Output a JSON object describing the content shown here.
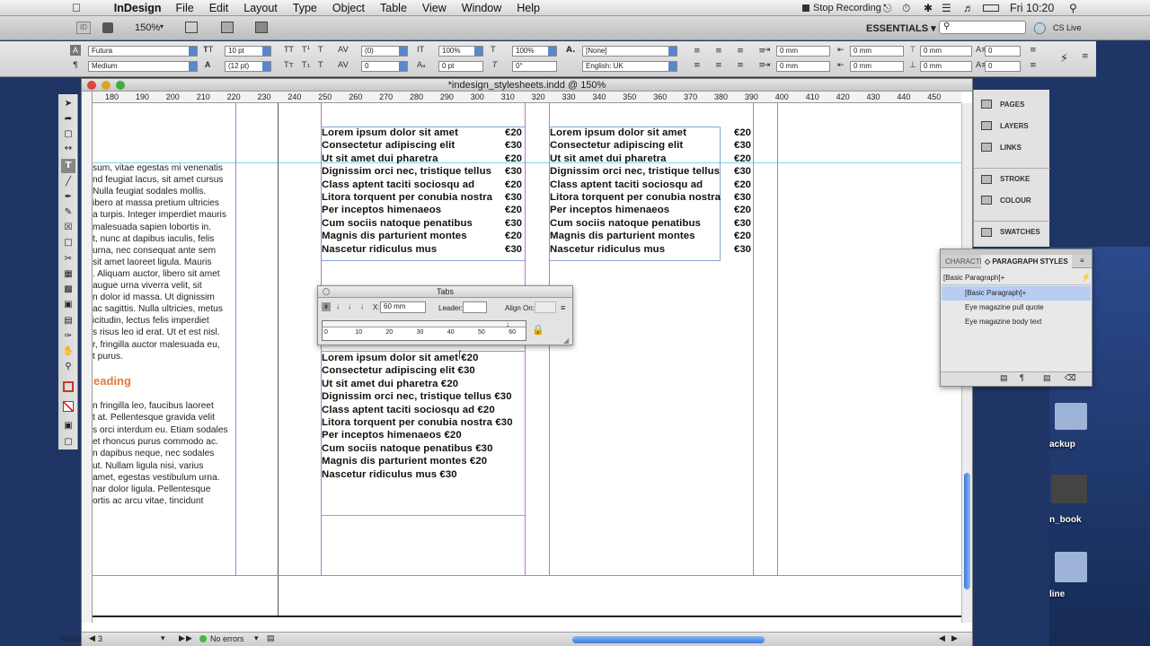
{
  "menubar": {
    "app": "InDesign",
    "items": [
      "File",
      "Edit",
      "Layout",
      "Type",
      "Object",
      "Table",
      "View",
      "Window",
      "Help"
    ],
    "recording": "Stop Recording",
    "clock": "Fri 10:20"
  },
  "appbar": {
    "zoom": "150%",
    "workspace": "ESSENTIALS ▾",
    "cs_live": "CS Live"
  },
  "control": {
    "font": "Futura",
    "style": "Medium",
    "size": "10 pt",
    "leading": "(12 pt)",
    "kerning": "(0)",
    "tracking": "0",
    "vscale": "100%",
    "hscale": "100%",
    "baseline": "0 pt",
    "skew": "0°",
    "char_style": "[None]",
    "language": "English: UK",
    "indent_left": "0 mm",
    "indent_right": "0 mm",
    "first_line": "0 mm",
    "last_line": "0 mm",
    "space_before": "0 mm",
    "space_after": "0 mm",
    "drop_cap_lines": "0",
    "drop_cap_chars": "0"
  },
  "document": {
    "title": "*indesign_stylesheets.indd @ 150%",
    "ruler_ticks": [
      "180",
      "190",
      "200",
      "210",
      "220",
      "230",
      "240",
      "250",
      "260",
      "270",
      "280",
      "290",
      "300",
      "310",
      "320",
      "330",
      "340",
      "350",
      "360",
      "370",
      "380",
      "390",
      "400",
      "410",
      "420",
      "430",
      "440",
      "450"
    ],
    "body_top": [
      "sum, vitae egestas mi venenatis",
      "nd feugiat lacus, sit amet cursus",
      "Nulla feugiat sodales mollis.",
      "ibero at massa pretium ultricies",
      "a turpis. Integer imperdiet mauris",
      "malesuada sapien lobortis in.",
      "t, nunc at dapibus iaculis, felis",
      "urna, nec consequat ante sem",
      "sit amet laoreet ligula. Mauris",
      ". Aliquam auctor, libero sit amet",
      "augue urna viverra velit, sit",
      "n dolor id massa. Ut dignissim",
      " ac sagittis. Nulla ultricies, metus",
      "icitudin, lectus felis imperdiet",
      "s risus leo id erat. Ut et est nisl.",
      "r, fringilla auctor malesuada eu,",
      "t purus."
    ],
    "heading": "eading",
    "body_bottom": [
      "n fringilla leo, faucibus laoreet",
      "t at. Pellentesque gravida velit",
      "s orci interdum eu. Etiam sodales",
      " et rhoncus purus commodo ac.",
      "n dapibus neque, nec sodales",
      "ut. Nullam ligula nisi, varius",
      " amet, egestas vestibulum urna.",
      "nar dolor ligula. Pellentesque",
      "ortis ac arcu vitae, tincidunt"
    ],
    "menu_a": [
      {
        "item": "Lorem ipsum dolor sit amet",
        "price": "€20"
      },
      {
        "item": "Consectetur adipiscing elit",
        "price": "€30"
      },
      {
        "item": "Ut sit amet dui pharetra",
        "price": "€20"
      },
      {
        "item": "Dignissim orci nec, tristique tellus",
        "price": "€30"
      },
      {
        "item": "Class aptent taciti sociosqu ad",
        "price": "€20"
      },
      {
        "item": "Litora torquent per conubia nostra",
        "price": "€30"
      },
      {
        "item": "Per inceptos himenaeos",
        "price": "€20"
      },
      {
        "item": "Cum sociis natoque penatibus",
        "price": "€30"
      },
      {
        "item": "Magnis dis parturient montes",
        "price": "€20"
      },
      {
        "item": "Nascetur ridiculus mus",
        "price": "€30"
      }
    ],
    "menu_c": [
      "Lorem ipsum dolor sit amet €20",
      "Consectetur adipiscing elit €30",
      "Ut sit amet dui pharetra €20",
      "Dignissim orci nec, tristique tellus €30",
      "Class aptent taciti sociosqu ad €20",
      "Litora torquent per conubia nostra €30",
      "Per inceptos himenaeos €20",
      "Cum sociis natoque penatibus €30",
      "Magnis dis parturient montes €20",
      "Nascetur ridiculus mus €30"
    ],
    "status": {
      "view": "Resol",
      "page": "3",
      "errors": "No errors"
    }
  },
  "tabs_panel": {
    "title": "Tabs",
    "x_label": "X:",
    "x_value": "60 mm",
    "leader_label": "Leader:",
    "align_label": "Align On:",
    "ruler": [
      "0",
      "10",
      "20",
      "30",
      "40",
      "50",
      "60"
    ]
  },
  "dock": [
    "PAGES",
    "LAYERS",
    "LINKS",
    "STROKE",
    "COLOUR",
    "SWATCHES"
  ],
  "pstyles": {
    "tab_char": "CHARACTE",
    "tab_para": "◇ PARAGRAPH STYLES",
    "current": "[Basic Paragraph]+",
    "items": [
      "[Basic Paragraph]+",
      "Eye magazine pull quote",
      "Eye magazine body text"
    ]
  },
  "desktop": [
    "ackup",
    "n_book",
    "line"
  ],
  "colors": {
    "accent": "#e07b39",
    "guide": "#b57acb",
    "selection": "#b7cdf4"
  }
}
